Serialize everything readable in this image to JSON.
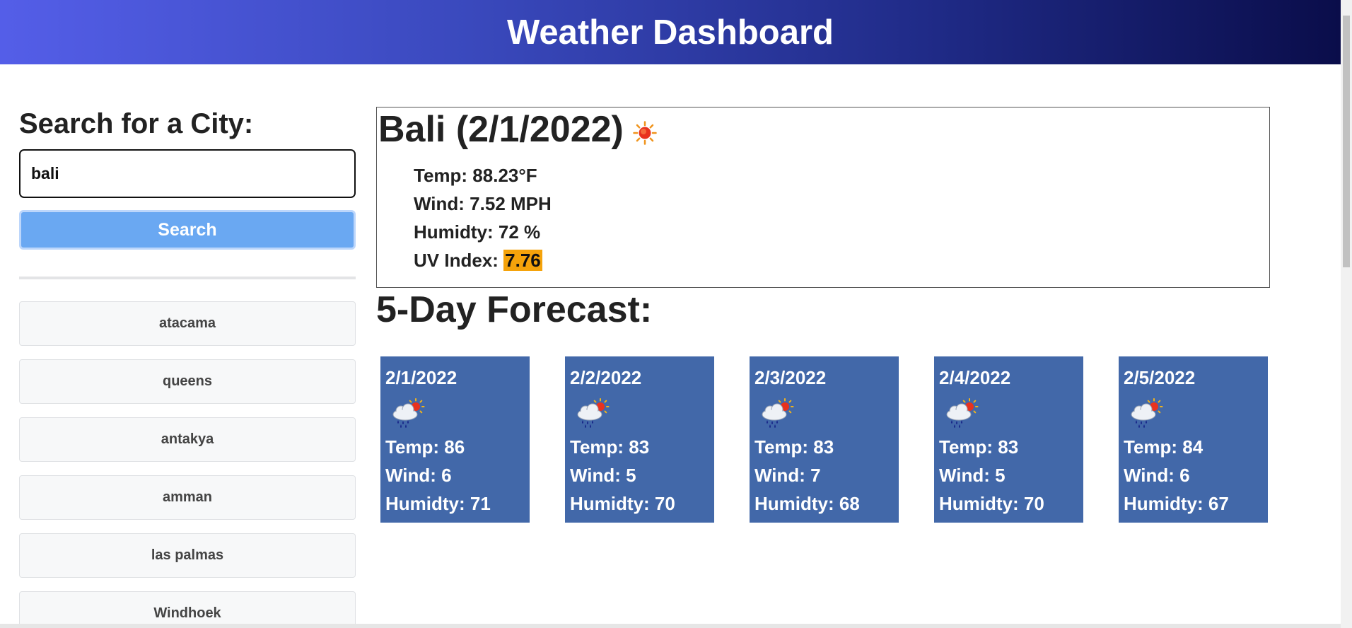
{
  "header": {
    "title": "Weather Dashboard"
  },
  "sidebar": {
    "heading": "Search for a City:",
    "search": {
      "value": "bali",
      "placeholder": ""
    },
    "search_button_label": "Search",
    "history": [
      {
        "label": "atacama"
      },
      {
        "label": "queens"
      },
      {
        "label": "antakya"
      },
      {
        "label": "amman"
      },
      {
        "label": "las palmas"
      },
      {
        "label": "Windhoek"
      }
    ]
  },
  "current": {
    "title": "Bali (2/1/2022)",
    "icon": "sun-icon",
    "temp": "Temp: 88.23°F",
    "wind": "Wind: 7.52 MPH",
    "humidity": "Humidty: 72 %",
    "uv_label": "UV Index: ",
    "uv_value": "7.76",
    "uv_color": "#f5a30b"
  },
  "forecast": {
    "heading": "5-Day Forecast:",
    "card_color": "#4268a9",
    "days": [
      {
        "date": "2/1/2022",
        "icon": "rain-sun-icon",
        "temp": "Temp: 86",
        "wind": "Wind: 6",
        "humidity": "Humidty: 71"
      },
      {
        "date": "2/2/2022",
        "icon": "rain-sun-icon",
        "temp": "Temp: 83",
        "wind": "Wind: 5",
        "humidity": "Humidty: 70"
      },
      {
        "date": "2/3/2022",
        "icon": "rain-sun-icon",
        "temp": "Temp: 83",
        "wind": "Wind: 7",
        "humidity": "Humidty: 68"
      },
      {
        "date": "2/4/2022",
        "icon": "rain-sun-icon",
        "temp": "Temp: 83",
        "wind": "Wind: 5",
        "humidity": "Humidty: 70"
      },
      {
        "date": "2/5/2022",
        "icon": "rain-sun-icon",
        "temp": "Temp: 84",
        "wind": "Wind: 6",
        "humidity": "Humidty: 67"
      }
    ]
  }
}
